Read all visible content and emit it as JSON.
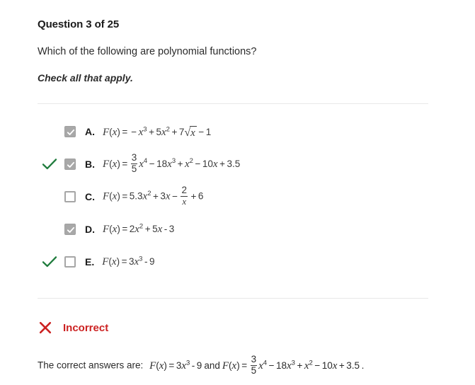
{
  "header": {
    "question_title": "Question 3 of 25",
    "prompt": "Which of the following are polynomial functions?",
    "instruction": "Check all that apply."
  },
  "choices": [
    {
      "letter": "A.",
      "checked": true,
      "is_correct": false,
      "expression_text": "F(x) = -x^3 + 5x^2 + 7√x - 1"
    },
    {
      "letter": "B.",
      "checked": true,
      "is_correct": true,
      "expression_text": "F(x) = 3/5 x^4 - 18x^3 + x^2 - 10x + 3.5"
    },
    {
      "letter": "C.",
      "checked": false,
      "is_correct": false,
      "expression_text": "F(x) = 5.3x^2 + 3x - 2/x + 6"
    },
    {
      "letter": "D.",
      "checked": true,
      "is_correct": false,
      "expression_text": "F(x) = 2x^2 + 5x - 3"
    },
    {
      "letter": "E.",
      "checked": false,
      "is_correct": true,
      "expression_text": "F(x) = 3x^3 - 9"
    }
  ],
  "feedback": {
    "icon": "x-mark-icon",
    "label": "Incorrect",
    "color": "#cc2222",
    "answer_lead": "The correct answers are:",
    "answer_first": "F(x) = 3x^3 - 9",
    "conjunction": "and",
    "answer_second": "F(x) = 3/5 x^4 - 18x^3 + x^2 - 10x + 3.5",
    "terminator": "."
  },
  "colors": {
    "correct_check": "#1e7b3c",
    "incorrect_red": "#cc2222",
    "checkbox_filled": "#a8a8a8",
    "checkbox_border": "#a6a6a6",
    "divider": "#e8e8e8",
    "text": "#2b2b2b"
  }
}
